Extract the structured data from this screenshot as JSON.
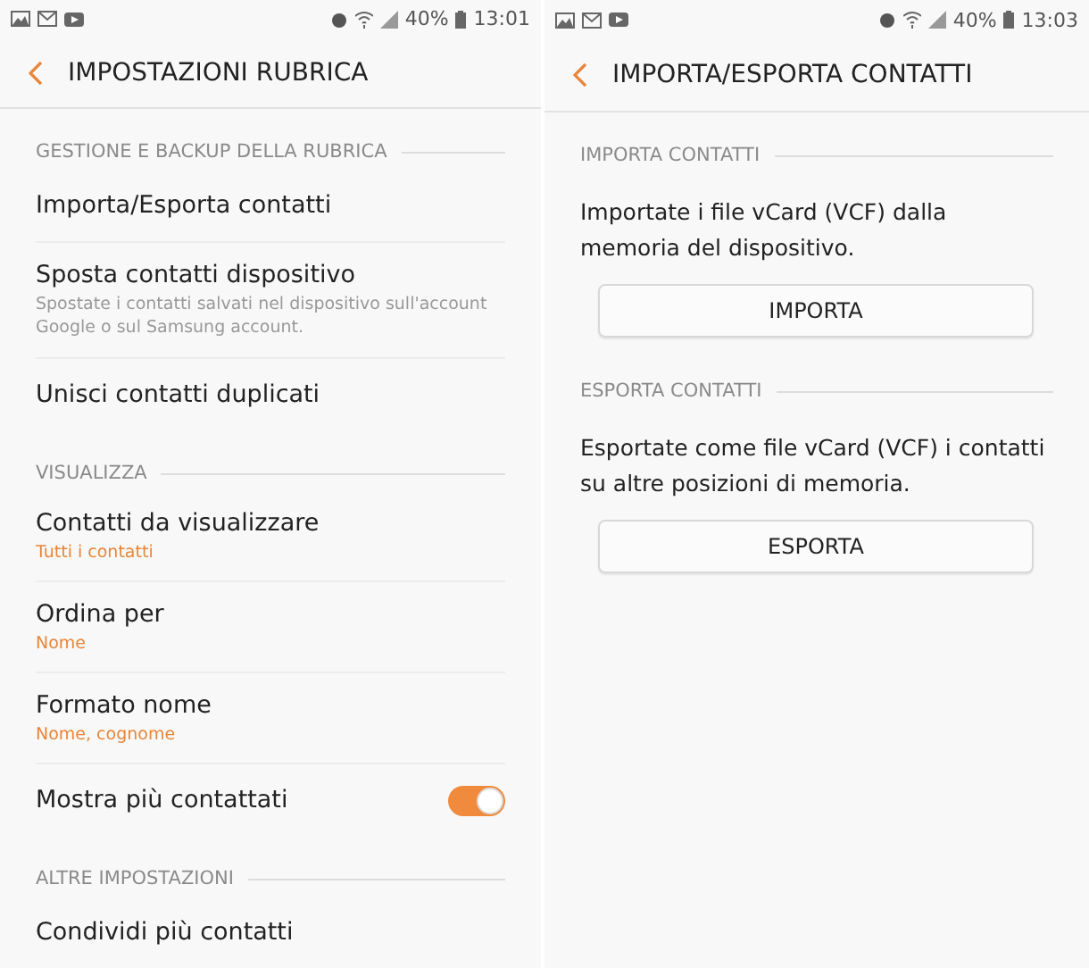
{
  "screens": [
    {
      "status_bar": {
        "battery": "40%",
        "time": "13:01"
      },
      "title": "IMPOSTAZIONI RUBRICA",
      "entries": [
        {
          "kind": "section",
          "label": "GESTIONE E BACKUP DELLA RUBRICA"
        },
        {
          "kind": "item",
          "label": "Importa/Esporta contatti"
        },
        {
          "kind": "item",
          "label": "Sposta contatti dispositivo",
          "description": "Spostate i contatti salvati nel dispositivo sull'account Google o sul Samsung account."
        },
        {
          "kind": "item",
          "label": "Unisci contatti duplicati"
        },
        {
          "kind": "section",
          "label": "VISUALIZZA"
        },
        {
          "kind": "item",
          "label": "Contatti da visualizzare",
          "value": "Tutti i contatti"
        },
        {
          "kind": "item",
          "label": "Ordina per",
          "value": "Nome"
        },
        {
          "kind": "item",
          "label": "Formato nome",
          "value": "Nome, cognome"
        },
        {
          "kind": "toggle",
          "label": "Mostra più contattati",
          "on": true
        },
        {
          "kind": "section",
          "label": "ALTRE IMPOSTAZIONI"
        },
        {
          "kind": "item",
          "label": "Condividi più contatti"
        }
      ]
    },
    {
      "status_bar": {
        "battery": "40%",
        "time": "13:03"
      },
      "title": "IMPORTA/ESPORTA CONTATTI",
      "entries": [
        {
          "kind": "section",
          "label": "IMPORTA CONTATTI"
        },
        {
          "kind": "text",
          "label": "Importate i file vCard (VCF) dalla memoria del dispositivo."
        },
        {
          "kind": "button",
          "label": "IMPORTA"
        },
        {
          "kind": "section",
          "label": "ESPORTA CONTATTI"
        },
        {
          "kind": "text",
          "label": "Esportate come file vCard (VCF) i contatti su altre posizioni di memoria."
        },
        {
          "kind": "button",
          "label": "ESPORTA"
        }
      ]
    }
  ]
}
